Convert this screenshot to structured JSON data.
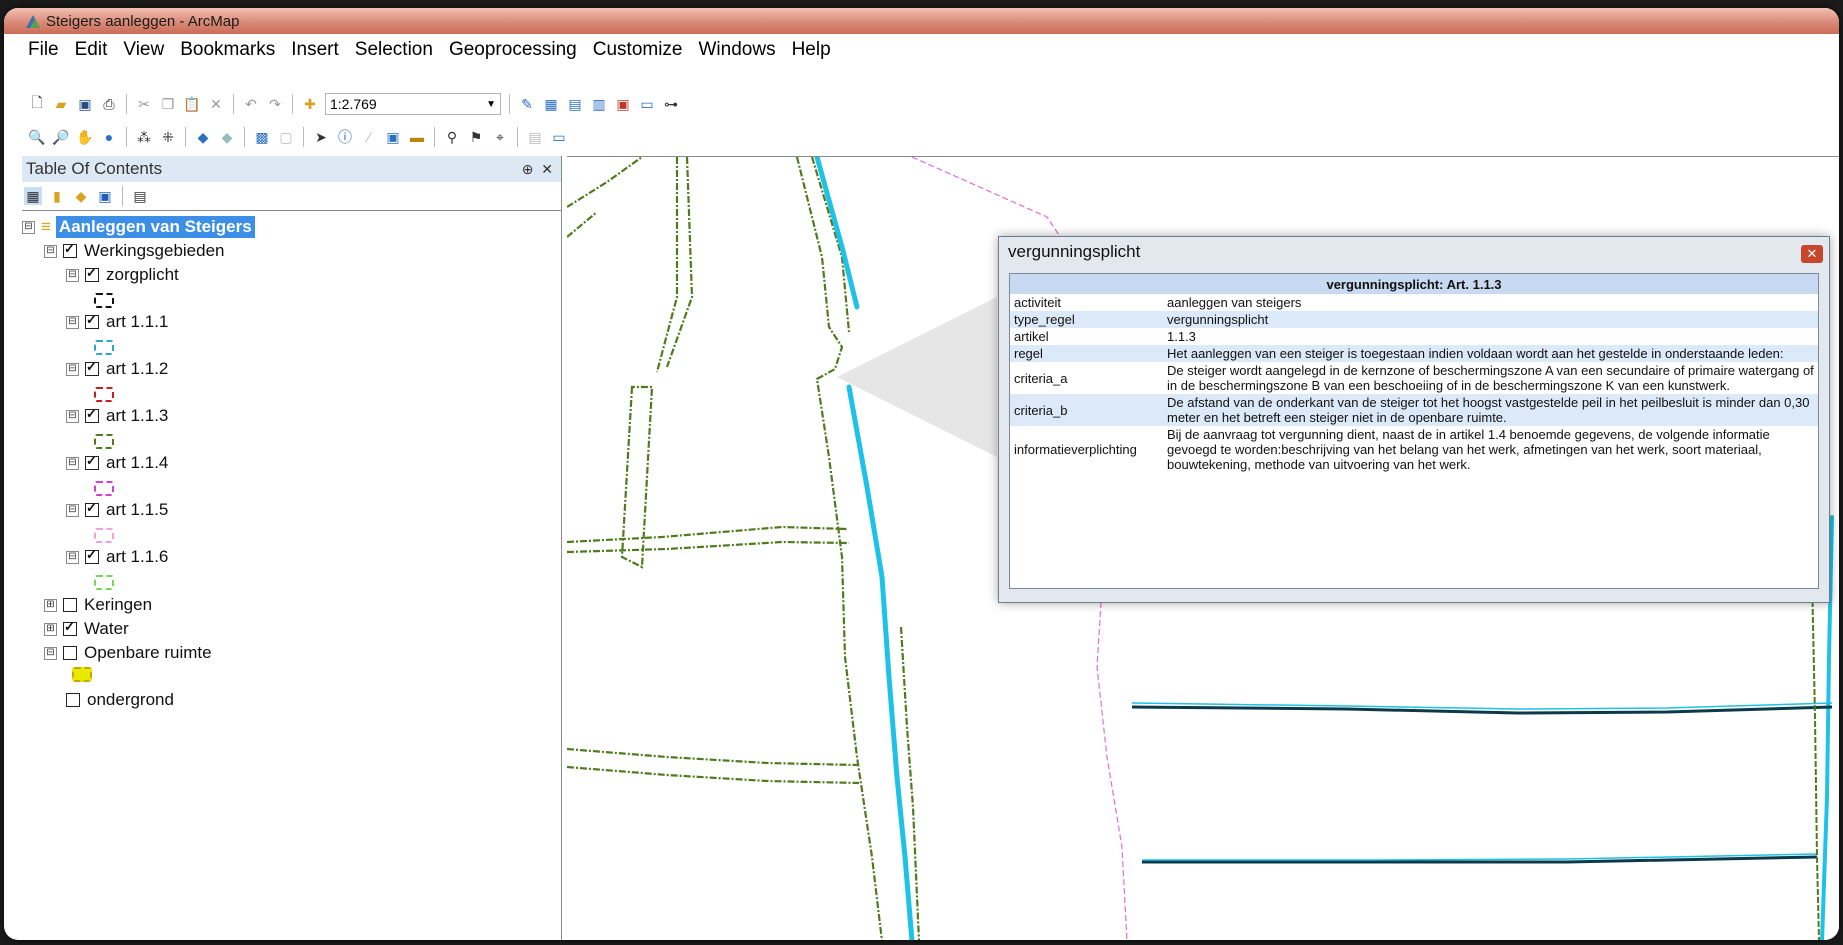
{
  "window": {
    "title": "Steigers aanleggen - ArcMap"
  },
  "menu": [
    "File",
    "Edit",
    "View",
    "Bookmarks",
    "Insert",
    "Selection",
    "Geoprocessing",
    "Customize",
    "Windows",
    "Help"
  ],
  "toolbar": {
    "scale": "1:2.769"
  },
  "toc": {
    "title": "Table Of Contents",
    "root": "Aanleggen van Steigers",
    "group": "Werkingsgebieden",
    "layers": [
      "zorgplicht",
      "art 1.1.1",
      "art 1.1.2",
      "art 1.1.3",
      "art 1.1.4",
      "art 1.1.5",
      "art 1.1.6"
    ],
    "others": [
      "Keringen",
      "Water",
      "Openbare ruimte",
      "ondergrond"
    ],
    "colors": [
      "#111111",
      "#2aa8c8",
      "#c0201e",
      "#4f7a1d",
      "#d040d8",
      "#f0a0e0",
      "#7ad858",
      "#e8e800"
    ]
  },
  "popup": {
    "title": "vergunningsplicht",
    "header": "vergunningsplicht: Art. 1.1.3",
    "rows": [
      {
        "k": "activiteit",
        "v": "aanleggen van steigers"
      },
      {
        "k": "type_regel",
        "v": "vergunningsplicht"
      },
      {
        "k": "artikel",
        "v": "1.1.3"
      },
      {
        "k": "regel",
        "v": "Het aanleggen van een steiger is toegestaan indien voldaan wordt aan het gestelde in onderstaande leden:"
      },
      {
        "k": "criteria_a",
        "v": "De steiger wordt aangelegd in de kernzone of beschermingszone A van een secundaire of primaire watergang of in de beschermingszone B van een beschoeiing of in de beschermingszone K van een kunstwerk."
      },
      {
        "k": "criteria_b",
        "v": "De afstand van de onderkant van de steiger tot het hoogst vastgestelde peil in het peilbesluit is minder dan 0,30 meter en het betreft een steiger niet in de openbare ruimte."
      },
      {
        "k": "informatieverplichting",
        "v": "Bij de aanvraag tot vergunning dient, naast de in artikel 1.4 benoemde gegevens, de volgende informatie gevoegd te worden:beschrijving van het belang van het werk, afmetingen van het werk, soort materiaal, bouwtekening, methode van uitvoering van het werk."
      }
    ]
  },
  "icons": [
    "app-icon",
    "new-icon",
    "open-icon",
    "save-icon",
    "print-icon",
    "cut-icon",
    "copy-icon",
    "paste-icon",
    "delete-icon",
    "undo-icon",
    "redo-icon",
    "add-data-icon",
    "zoom-in-icon",
    "zoom-out-icon",
    "pan-icon",
    "globe-icon",
    "identify-icon",
    "find-icon",
    "close-icon"
  ]
}
